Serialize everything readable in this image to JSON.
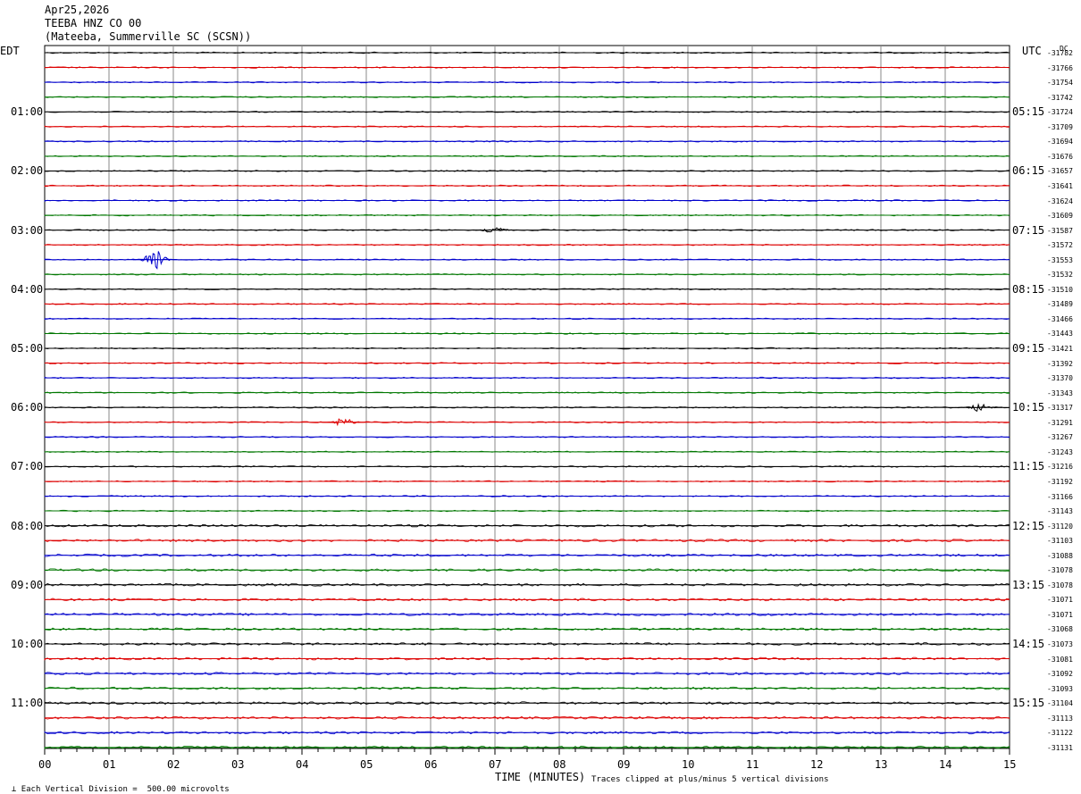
{
  "header": {
    "date": "Apr25,2026",
    "station": "TEEBA HNZ CO 00",
    "location": "(Mateeba, Summerville SC (SCSN))"
  },
  "left_zone_label": "EDT",
  "right_zone_label": "UTC",
  "dc_header": "DC",
  "trace_colors": [
    "#000000",
    "#dd0000",
    "#0000cc",
    "#007700"
  ],
  "grid_color": "#888888",
  "chart_data": {
    "type": "line",
    "title": "TEEBA HNZ CO 00",
    "xlabel": "TIME (MINUTES)",
    "xlim": [
      0,
      15
    ],
    "x_ticks": [
      "00",
      "01",
      "02",
      "03",
      "04",
      "05",
      "06",
      "07",
      "08",
      "09",
      "10",
      "11",
      "12",
      "13",
      "14",
      "15"
    ],
    "left_time_labels": [
      "01:00",
      "02:00",
      "03:00",
      "04:00",
      "05:00",
      "06:00",
      "07:00",
      "08:00",
      "09:00",
      "10:00",
      "11:00"
    ],
    "right_time_labels": [
      "05:15",
      "06:15",
      "07:15",
      "08:15",
      "09:15",
      "10:15",
      "11:15",
      "12:15",
      "13:15",
      "14:15",
      "15:15"
    ],
    "traces_per_hour": 4,
    "trace_count": 48,
    "dc_offsets": [
      "-31782",
      "-31766",
      "-31754",
      "-31742",
      "-31724",
      "-31709",
      "-31694",
      "-31676",
      "-31657",
      "-31641",
      "-31624",
      "-31609",
      "-31587",
      "-31572",
      "-31553",
      "-31532",
      "-31510",
      "-31489",
      "-31466",
      "-31443",
      "-31421",
      "-31392",
      "-31370",
      "-31343",
      "-31317",
      "-31291",
      "-31267",
      "-31243",
      "-31216",
      "-31192",
      "-31166",
      "-31143",
      "-31120",
      "-31103",
      "-31088",
      "-31078",
      "-31078",
      "-31071",
      "-31071",
      "-31068",
      "-31073",
      "-31081",
      "-31092",
      "-31093",
      "-31104",
      "-31113",
      "-31122",
      "-31131"
    ],
    "events": [
      {
        "trace": 14,
        "minute": 1.72,
        "amplitude": 0.9
      },
      {
        "trace": 25,
        "minute": 4.65,
        "amplitude": 0.35
      },
      {
        "trace": 24,
        "minute": 14.55,
        "amplitude": 0.3
      },
      {
        "trace": 12,
        "minute": 7.0,
        "amplitude": 0.35
      }
    ],
    "scale_note": "Each Vertical Division =  500.00 microvolts",
    "clip_note": "Traces clipped at plus/minus 5 vertical divisions"
  }
}
